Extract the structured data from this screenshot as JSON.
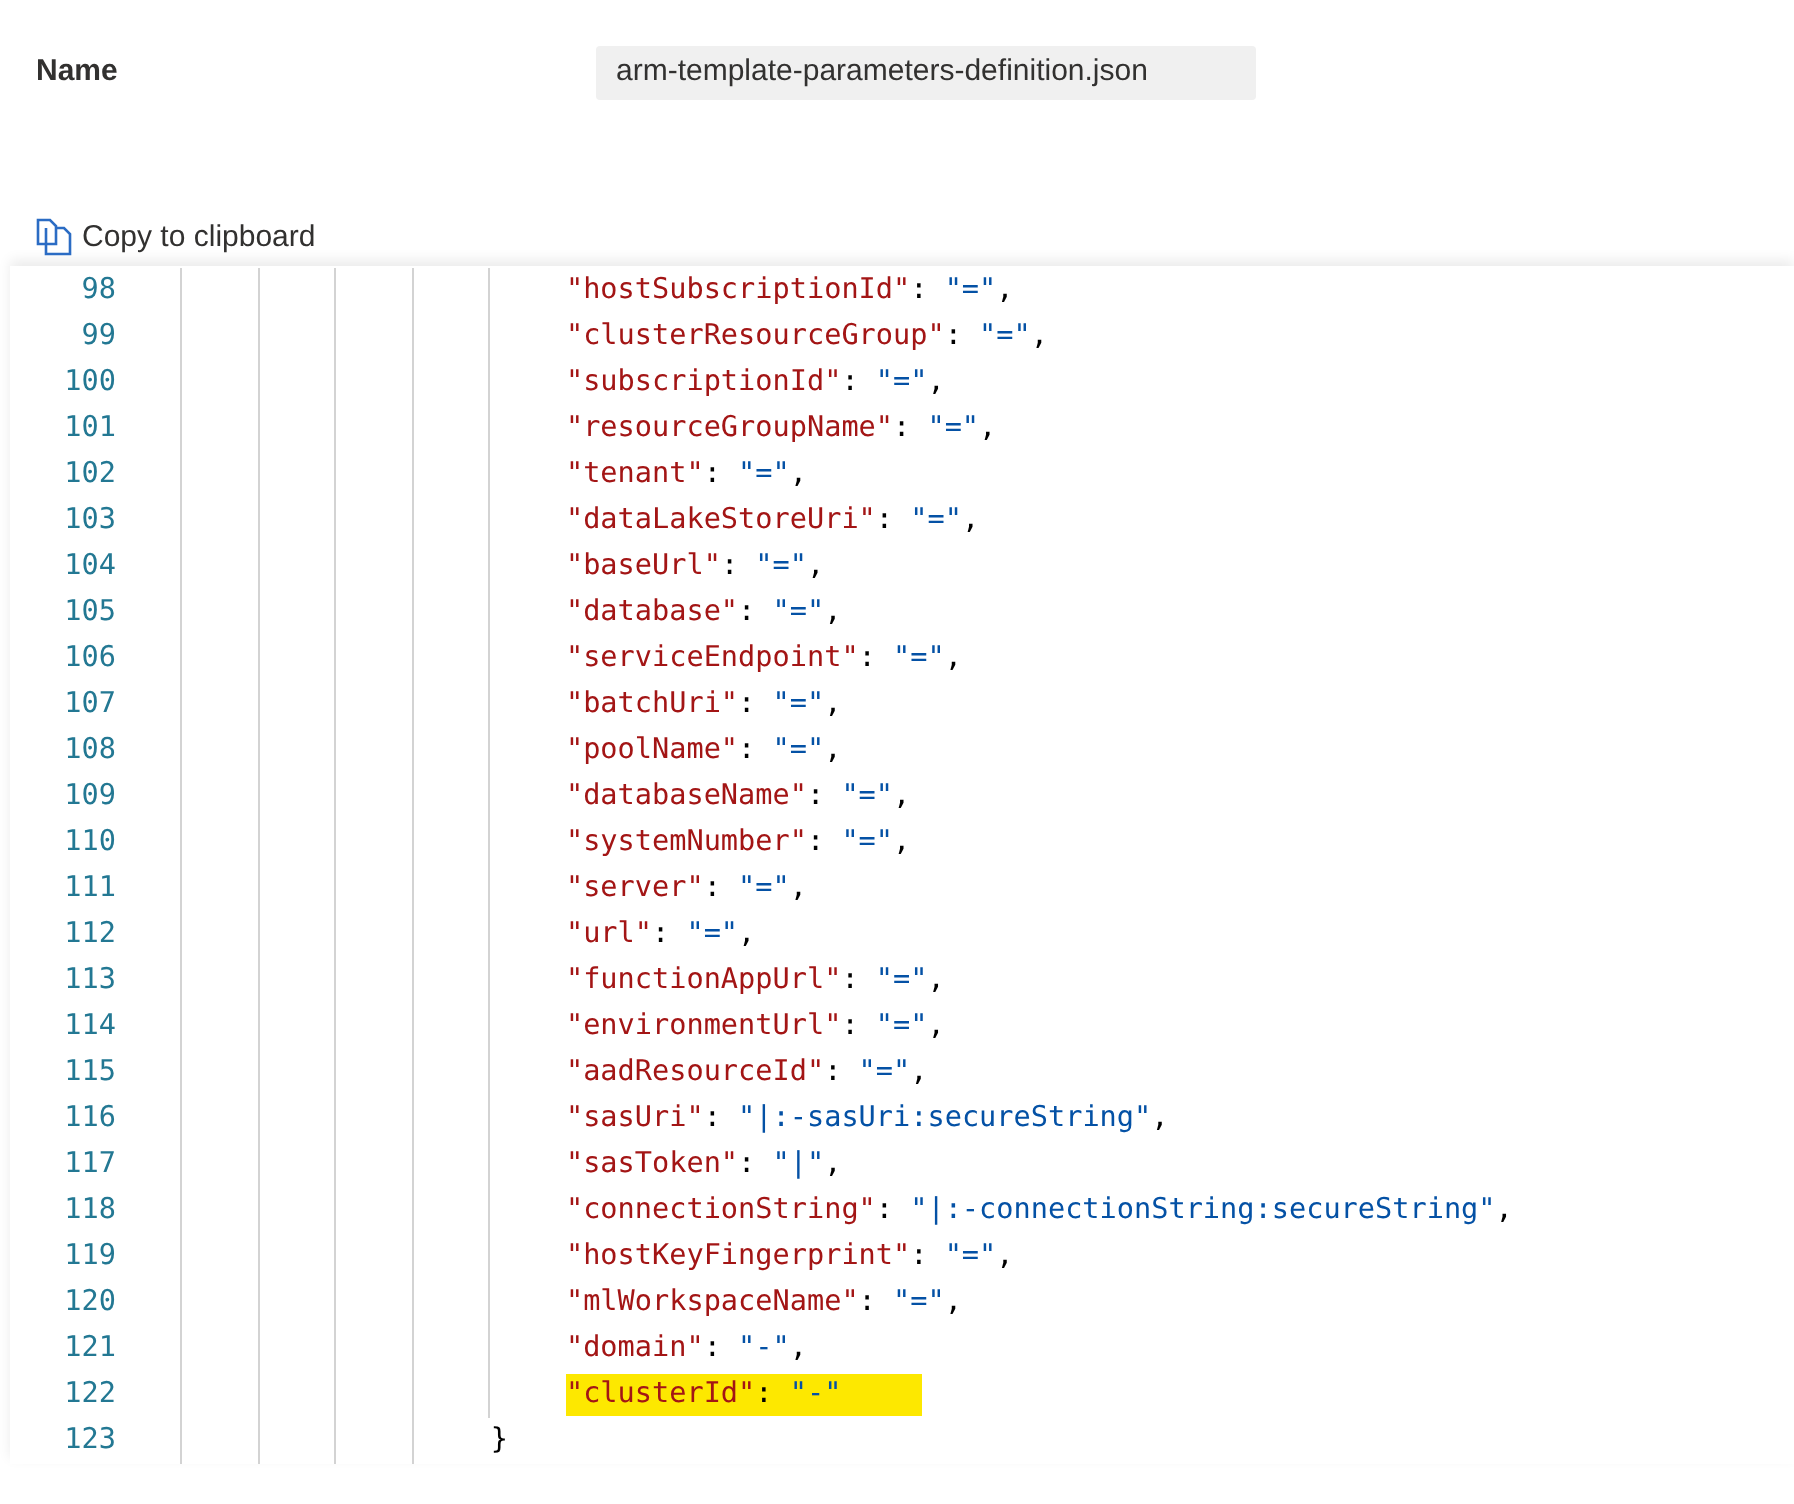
{
  "name_label": "Name",
  "file_name": "arm-template-parameters-definition.json",
  "copy_button": "Copy to clipboard",
  "lines": [
    {
      "kind": "pair",
      "number": "98",
      "key": "\"hostSubscriptionId\"",
      "colon": ":",
      "value": "\"=\"",
      "suffix": ",",
      "highlighted": false
    },
    {
      "kind": "pair",
      "number": "99",
      "key": "\"clusterResourceGroup\"",
      "colon": ":",
      "value": "\"=\"",
      "suffix": ",",
      "highlighted": false
    },
    {
      "kind": "pair",
      "number": "100",
      "key": "\"subscriptionId\"",
      "colon": ":",
      "value": "\"=\"",
      "suffix": ",",
      "highlighted": false
    },
    {
      "kind": "pair",
      "number": "101",
      "key": "\"resourceGroupName\"",
      "colon": ":",
      "value": "\"=\"",
      "suffix": ",",
      "highlighted": false
    },
    {
      "kind": "pair",
      "number": "102",
      "key": "\"tenant\"",
      "colon": ":",
      "value": "\"=\"",
      "suffix": ",",
      "highlighted": false
    },
    {
      "kind": "pair",
      "number": "103",
      "key": "\"dataLakeStoreUri\"",
      "colon": ":",
      "value": "\"=\"",
      "suffix": ",",
      "highlighted": false
    },
    {
      "kind": "pair",
      "number": "104",
      "key": "\"baseUrl\"",
      "colon": ":",
      "value": "\"=\"",
      "suffix": ",",
      "highlighted": false
    },
    {
      "kind": "pair",
      "number": "105",
      "key": "\"database\"",
      "colon": ":",
      "value": "\"=\"",
      "suffix": ",",
      "highlighted": false
    },
    {
      "kind": "pair",
      "number": "106",
      "key": "\"serviceEndpoint\"",
      "colon": ":",
      "value": "\"=\"",
      "suffix": ",",
      "highlighted": false
    },
    {
      "kind": "pair",
      "number": "107",
      "key": "\"batchUri\"",
      "colon": ":",
      "value": "\"=\"",
      "suffix": ",",
      "highlighted": false
    },
    {
      "kind": "pair",
      "number": "108",
      "key": "\"poolName\"",
      "colon": ":",
      "value": "\"=\"",
      "suffix": ",",
      "highlighted": false
    },
    {
      "kind": "pair",
      "number": "109",
      "key": "\"databaseName\"",
      "colon": ":",
      "value": "\"=\"",
      "suffix": ",",
      "highlighted": false
    },
    {
      "kind": "pair",
      "number": "110",
      "key": "\"systemNumber\"",
      "colon": ":",
      "value": "\"=\"",
      "suffix": ",",
      "highlighted": false
    },
    {
      "kind": "pair",
      "number": "111",
      "key": "\"server\"",
      "colon": ":",
      "value": "\"=\"",
      "suffix": ",",
      "highlighted": false
    },
    {
      "kind": "pair",
      "number": "112",
      "key": "\"url\"",
      "colon": ":",
      "value": "\"=\"",
      "suffix": ",",
      "highlighted": false
    },
    {
      "kind": "pair",
      "number": "113",
      "key": "\"functionAppUrl\"",
      "colon": ":",
      "value": "\"=\"",
      "suffix": ",",
      "highlighted": false
    },
    {
      "kind": "pair",
      "number": "114",
      "key": "\"environmentUrl\"",
      "colon": ":",
      "value": "\"=\"",
      "suffix": ",",
      "highlighted": false
    },
    {
      "kind": "pair",
      "number": "115",
      "key": "\"aadResourceId\"",
      "colon": ":",
      "value": "\"=\"",
      "suffix": ",",
      "highlighted": false
    },
    {
      "kind": "pair",
      "number": "116",
      "key": "\"sasUri\"",
      "colon": ":",
      "value": "\"|:-sasUri:secureString\"",
      "suffix": ",",
      "highlighted": false
    },
    {
      "kind": "pair",
      "number": "117",
      "key": "\"sasToken\"",
      "colon": ":",
      "value": "\"|\"",
      "suffix": ",",
      "highlighted": false
    },
    {
      "kind": "pair",
      "number": "118",
      "key": "\"connectionString\"",
      "colon": ":",
      "value": "\"|:-connectionString:secureString\"",
      "suffix": ",",
      "highlighted": false
    },
    {
      "kind": "pair",
      "number": "119",
      "key": "\"hostKeyFingerprint\"",
      "colon": ":",
      "value": "\"=\"",
      "suffix": ",",
      "highlighted": false
    },
    {
      "kind": "pair",
      "number": "120",
      "key": "\"mlWorkspaceName\"",
      "colon": ":",
      "value": "\"=\"",
      "suffix": ",",
      "highlighted": false
    },
    {
      "kind": "pair",
      "number": "121",
      "key": "\"domain\"",
      "colon": ":",
      "value": "\"-\"",
      "suffix": ",",
      "highlighted": false
    },
    {
      "kind": "pair",
      "number": "122",
      "key": "\"clusterId\"",
      "colon": ":",
      "value": "\"-\"",
      "highlighted": true
    },
    {
      "kind": "brace",
      "number": "123",
      "text": "}"
    }
  ]
}
